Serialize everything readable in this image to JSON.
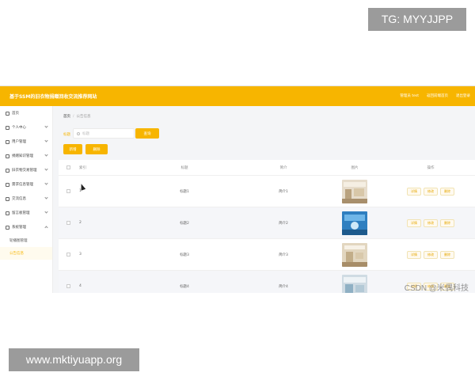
{
  "watermarks": {
    "top": "TG: MYYJJPP",
    "bottom": "www.mktiyuapp.org",
    "csdn": "CSDN @米偶科技"
  },
  "app": {
    "title": "基于SSM的旧衣物捐赠回收交流推荐网站",
    "top_links": [
      "管理员 test",
      "返回前端首页",
      "退出登录"
    ]
  },
  "sidebar": {
    "items": [
      {
        "label": "首页",
        "icon": "home-icon"
      },
      {
        "label": "个人中心",
        "icon": "user-icon"
      },
      {
        "label": "用户管理",
        "icon": "users-icon"
      },
      {
        "label": "捐赠知识管理",
        "icon": "book-icon"
      },
      {
        "label": "旧衣物交易管理",
        "icon": "shirt-icon"
      },
      {
        "label": "需求信息管理",
        "icon": "list-icon"
      },
      {
        "label": "交流信息",
        "icon": "chat-icon"
      },
      {
        "label": "留言板管理",
        "icon": "message-icon"
      },
      {
        "label": "系统管理",
        "icon": "gear-icon"
      }
    ],
    "subitems": [
      {
        "label": "轮播图管理",
        "active": false
      },
      {
        "label": "公告信息",
        "active": true
      }
    ]
  },
  "breadcrumb": {
    "home": "首页",
    "current": "公告信息"
  },
  "search": {
    "label": "标题",
    "placeholder": "标题",
    "query_button": "查询"
  },
  "actions": {
    "add": "新增",
    "delete": "删除"
  },
  "table": {
    "headers": {
      "index": "索引",
      "title": "标题",
      "brief": "简介",
      "image": "图片",
      "ops": "操作"
    },
    "rows": [
      {
        "index": "1",
        "title": "标题1",
        "brief": "简介1",
        "thumb_color": "#c9b79a"
      },
      {
        "index": "2",
        "title": "标题2",
        "brief": "简介2",
        "thumb_color": "#3a8fd0"
      },
      {
        "index": "3",
        "title": "标题3",
        "brief": "简介3",
        "thumb_color": "#c8b28c"
      },
      {
        "index": "4",
        "title": "标题4",
        "brief": "简介4",
        "thumb_color": "#9ab7c9"
      }
    ],
    "op_labels": [
      "详情",
      "修改",
      "删除"
    ]
  },
  "colors": {
    "accent": "#f7b500"
  }
}
